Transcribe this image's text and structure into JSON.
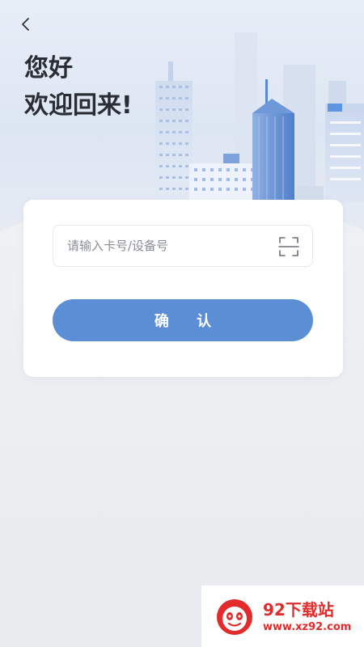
{
  "greeting": {
    "line1": "您好",
    "line2": "欢迎回来!"
  },
  "card": {
    "input_placeholder": "请输入卡号/设备号",
    "input_value": "",
    "confirm_label": "确 认"
  },
  "icons": {
    "back": "chevron-left-icon",
    "scan": "scan-icon"
  },
  "watermark": {
    "title": "92下载站",
    "url": "www.xz92.com"
  },
  "colors": {
    "accent": "#5b8ed4",
    "text_dark": "#2a2d33",
    "placeholder": "#8a8e96",
    "watermark_red": "#e32b2b"
  }
}
